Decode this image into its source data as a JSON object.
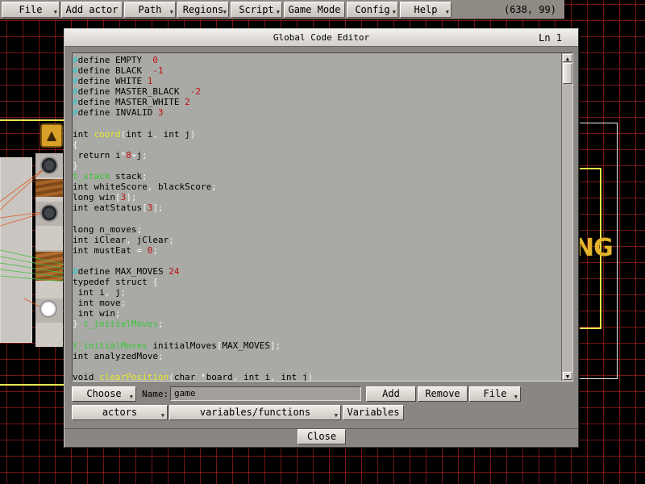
{
  "menu": {
    "items": [
      {
        "label": "File",
        "dropdown": true
      },
      {
        "label": "Add actor",
        "dropdown": false
      },
      {
        "label": "Path",
        "dropdown": true
      },
      {
        "label": "Regions",
        "dropdown": true
      },
      {
        "label": "Script",
        "dropdown": true
      },
      {
        "label": "Game Mode",
        "dropdown": false
      },
      {
        "label": "Config",
        "dropdown": true
      },
      {
        "label": "Help",
        "dropdown": true
      }
    ],
    "coordinates": "(638, 99)"
  },
  "dialog": {
    "title": "Global Code Editor",
    "line_indicator": "Ln 1",
    "code_lines": [
      [
        [
          "cy",
          "#"
        ],
        [
          "kw",
          "define EMPTY  "
        ],
        [
          "rd",
          "0"
        ]
      ],
      [
        [
          "cy",
          "#"
        ],
        [
          "kw",
          "define BLACK  "
        ],
        [
          "rd",
          "-1"
        ]
      ],
      [
        [
          "cy",
          "#"
        ],
        [
          "kw",
          "define WHITE "
        ],
        [
          "rd",
          "1"
        ]
      ],
      [
        [
          "cy",
          "#"
        ],
        [
          "kw",
          "define MASTER_BLACK  "
        ],
        [
          "rd",
          "-2"
        ]
      ],
      [
        [
          "cy",
          "#"
        ],
        [
          "kw",
          "define MASTER_WHITE "
        ],
        [
          "rd",
          "2"
        ]
      ],
      [
        [
          "cy",
          "#"
        ],
        [
          "kw",
          "define INVALID "
        ],
        [
          "rd",
          "3"
        ]
      ],
      [],
      [
        [
          "kw",
          "int "
        ],
        [
          "yl",
          "coord"
        ],
        [
          "wh",
          "("
        ],
        [
          "kw",
          "int i"
        ],
        [
          "wh",
          ", "
        ],
        [
          "kw",
          "int j"
        ],
        [
          "wh",
          ")"
        ]
      ],
      [
        [
          "wh",
          "{"
        ]
      ],
      [
        [
          "kw",
          " return "
        ],
        [
          "kw",
          "i"
        ],
        [
          "wh",
          "*"
        ],
        [
          "rd",
          "8"
        ],
        [
          "wh",
          "+"
        ],
        [
          "kw",
          "j"
        ],
        [
          "wh",
          ";"
        ]
      ],
      [
        [
          "wh",
          "}"
        ]
      ],
      [
        [
          "gr",
          "t_stack"
        ],
        [
          "kw",
          " stack"
        ],
        [
          "wh",
          ";"
        ]
      ],
      [
        [
          "kw",
          "int whiteScore"
        ],
        [
          "wh",
          ", "
        ],
        [
          "kw",
          "blackScore"
        ],
        [
          "wh",
          ";"
        ]
      ],
      [
        [
          "kw",
          "long win"
        ],
        [
          "wh",
          "["
        ],
        [
          "rd",
          "3"
        ],
        [
          "wh",
          "];"
        ]
      ],
      [
        [
          "kw",
          "int eatStatus"
        ],
        [
          "wh",
          "["
        ],
        [
          "rd",
          "3"
        ],
        [
          "wh",
          "];"
        ]
      ],
      [],
      [
        [
          "kw",
          "long n_moves"
        ],
        [
          "wh",
          ";"
        ]
      ],
      [
        [
          "kw",
          "int iClear"
        ],
        [
          "wh",
          ", "
        ],
        [
          "kw",
          "jClear"
        ],
        [
          "wh",
          ";"
        ]
      ],
      [
        [
          "kw",
          "int mustEat "
        ],
        [
          "wh",
          "= "
        ],
        [
          "rd",
          "0"
        ],
        [
          "wh",
          ";"
        ]
      ],
      [],
      [
        [
          "cy",
          "#"
        ],
        [
          "kw",
          "define MAX_MOVES "
        ],
        [
          "rd",
          "24"
        ]
      ],
      [
        [
          "kw",
          "typedef struct "
        ],
        [
          "wh",
          "{"
        ]
      ],
      [
        [
          "kw",
          " int i"
        ],
        [
          "wh",
          ", "
        ],
        [
          "kw",
          "j"
        ],
        [
          "wh",
          ";"
        ]
      ],
      [
        [
          "kw",
          " int move"
        ],
        [
          "wh",
          ";"
        ]
      ],
      [
        [
          "kw",
          " int win"
        ],
        [
          "wh",
          ";"
        ]
      ],
      [
        [
          "wh",
          "} "
        ],
        [
          "gr",
          "t_initialMoves"
        ],
        [
          "wh",
          ";"
        ]
      ],
      [],
      [
        [
          "gr",
          "t_initialMoves"
        ],
        [
          "kw",
          " initialMoves"
        ],
        [
          "wh",
          "["
        ],
        [
          "kw",
          "MAX_MOVES"
        ],
        [
          "wh",
          "];"
        ]
      ],
      [
        [
          "kw",
          "int analyzedMove"
        ],
        [
          "wh",
          ";"
        ]
      ],
      [],
      [
        [
          "kw",
          "void "
        ],
        [
          "yl",
          "clearPosition"
        ],
        [
          "wh",
          "("
        ],
        [
          "kw",
          "char "
        ],
        [
          "wh",
          "*"
        ],
        [
          "kw",
          "board"
        ],
        [
          "wh",
          ", "
        ],
        [
          "kw",
          "int i"
        ],
        [
          "wh",
          ", "
        ],
        [
          "kw",
          "int j"
        ],
        [
          "wh",
          ")"
        ]
      ]
    ],
    "row1": {
      "choose_label": "Choose",
      "name_label": "Name:",
      "name_value": "game",
      "add_label": "Add",
      "remove_label": "Remove",
      "file_label": "File"
    },
    "row2": {
      "actors_label": "actors",
      "varfunc_label": "variables/functions",
      "variables_label": "Variables"
    },
    "close_label": "Close"
  },
  "colors": {
    "cyan": "#33c8c8",
    "red": "#c01010",
    "yellow": "#e8e830",
    "green": "#38c838"
  }
}
